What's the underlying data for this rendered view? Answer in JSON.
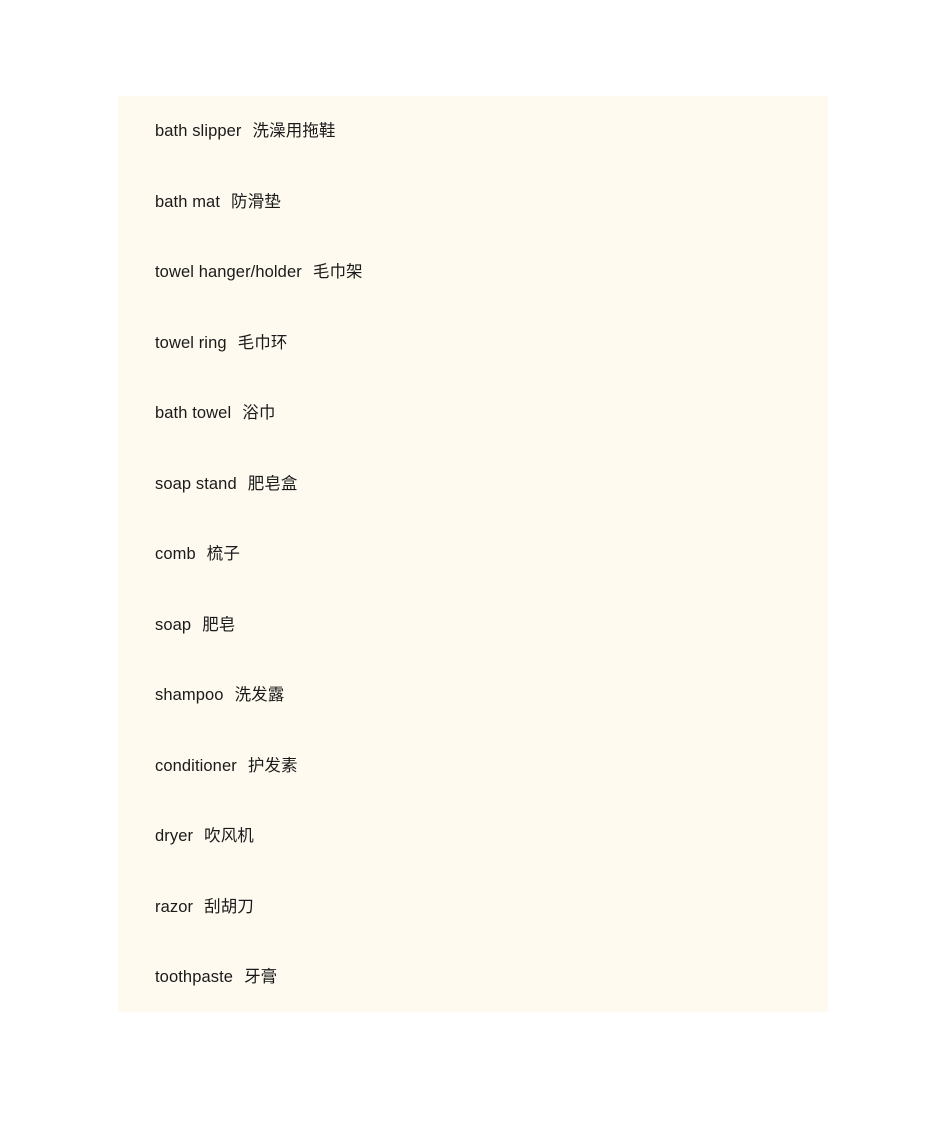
{
  "page": {
    "background_color": "#ffffff",
    "panel_background_color": "#fffaf0",
    "text_color": "#1a1a1a"
  },
  "panel": {
    "entries": [
      {
        "english": "bath slipper",
        "chinese": "洗澡用拖鞋"
      },
      {
        "english": "bath mat",
        "chinese": "防滑垫"
      },
      {
        "english": "towel hanger/holder",
        "chinese": "毛巾架"
      },
      {
        "english": "towel ring",
        "chinese": "毛巾环"
      },
      {
        "english": "bath towel",
        "chinese": "浴巾"
      },
      {
        "english": "soap stand",
        "chinese": "肥皂盒"
      },
      {
        "english": "comb",
        "chinese": "梳子"
      },
      {
        "english": "soap",
        "chinese": "肥皂"
      },
      {
        "english": "shampoo",
        "chinese": "洗发露"
      },
      {
        "english": "conditioner",
        "chinese": "护发素"
      },
      {
        "english": "dryer",
        "chinese": "吹风机"
      },
      {
        "english": "razor",
        "chinese": "刮胡刀"
      },
      {
        "english": "toothpaste",
        "chinese": "牙膏"
      }
    ]
  }
}
